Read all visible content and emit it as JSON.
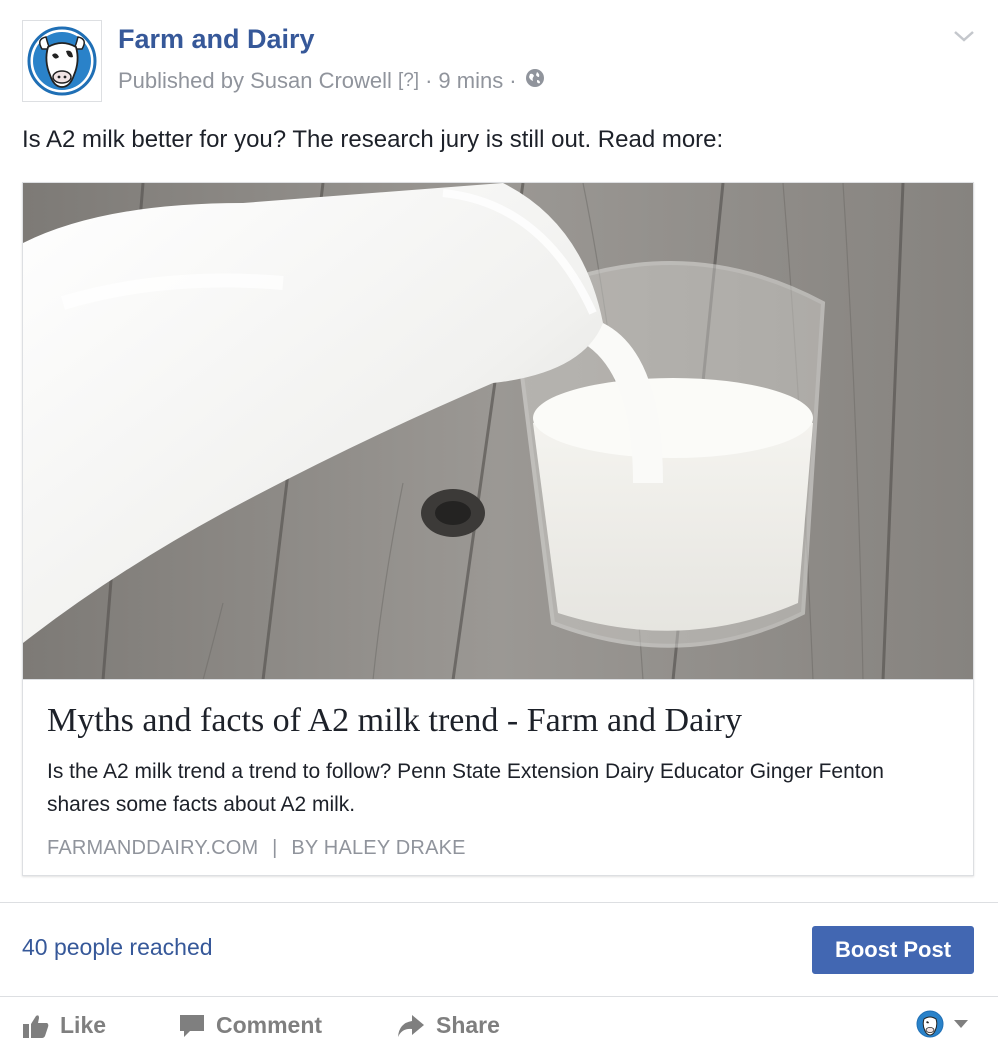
{
  "header": {
    "page_name": "Farm and Dairy",
    "published_by": "Published by Susan Crowell",
    "help_marker": "[?]",
    "separator": "·",
    "time_ago": "9 mins",
    "privacy_icon": "globe-icon"
  },
  "post": {
    "text": "Is A2 milk better for you? The research jury is still out. Read more:"
  },
  "link_card": {
    "image": "milk-pouring-into-glass",
    "title": "Myths and facts of A2 milk trend - Farm and Dairy",
    "description": "Is the A2 milk trend a trend to follow? Penn State Extension Dairy Educator Ginger Fenton shares some facts about A2 milk.",
    "source": "FARMANDDAIRY.COM",
    "source_separator": "|",
    "byline": "BY HALEY DRAKE"
  },
  "insights": {
    "reach": "40 people reached",
    "boost_label": "Boost Post"
  },
  "actions": {
    "like": "Like",
    "comment": "Comment",
    "share": "Share"
  },
  "colors": {
    "link_blue": "#365899",
    "boost_blue": "#4267b2",
    "meta_gray": "#90949c",
    "action_gray": "#7f7f7f"
  }
}
